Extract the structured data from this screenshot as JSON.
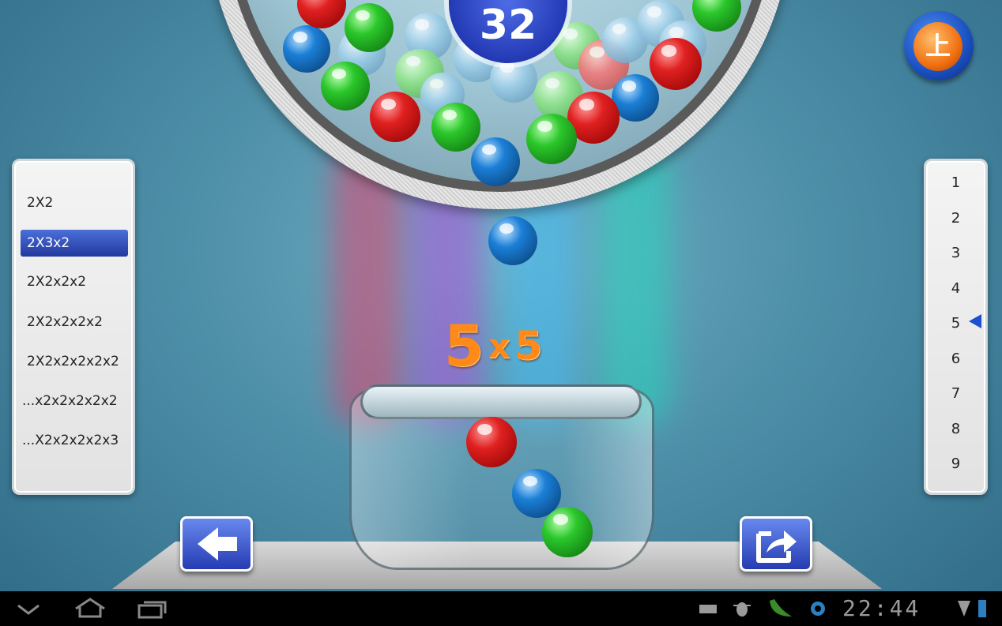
{
  "game": {
    "counter": "32",
    "equation": {
      "left": "5",
      "op": "x",
      "right": "5"
    }
  },
  "formula_list": {
    "items": [
      "2X2",
      "2X3x2",
      "2X2x2x2",
      "2X2x2x2x2",
      "2X2x2x2x2x2",
      "...x2x2x2x2x2",
      "...X2x2x2x2x3"
    ],
    "selected_index": 1
  },
  "number_list": {
    "items": [
      "1",
      "2",
      "3",
      "4",
      "5",
      "6",
      "7",
      "8",
      "9"
    ],
    "selected": "5"
  },
  "mode_button": {
    "label": "上"
  },
  "buttons": {
    "back_icon": "arrow-left-icon",
    "share_icon": "share-export-icon"
  },
  "colors": {
    "red": "#e02020",
    "green": "#2bc72b",
    "blue": "#1b7fd6",
    "accent": "#ff8a1a",
    "button": "#2338b0"
  },
  "system_bar": {
    "time": "22:44",
    "nav_icons": [
      "chevron-down-icon",
      "home-icon",
      "recent-apps-icon"
    ],
    "status_icons": [
      "keyboard-icon",
      "bug-icon",
      "pea-pod-icon",
      "settings-gear-icon",
      "signal-icon",
      "battery-icon"
    ]
  }
}
